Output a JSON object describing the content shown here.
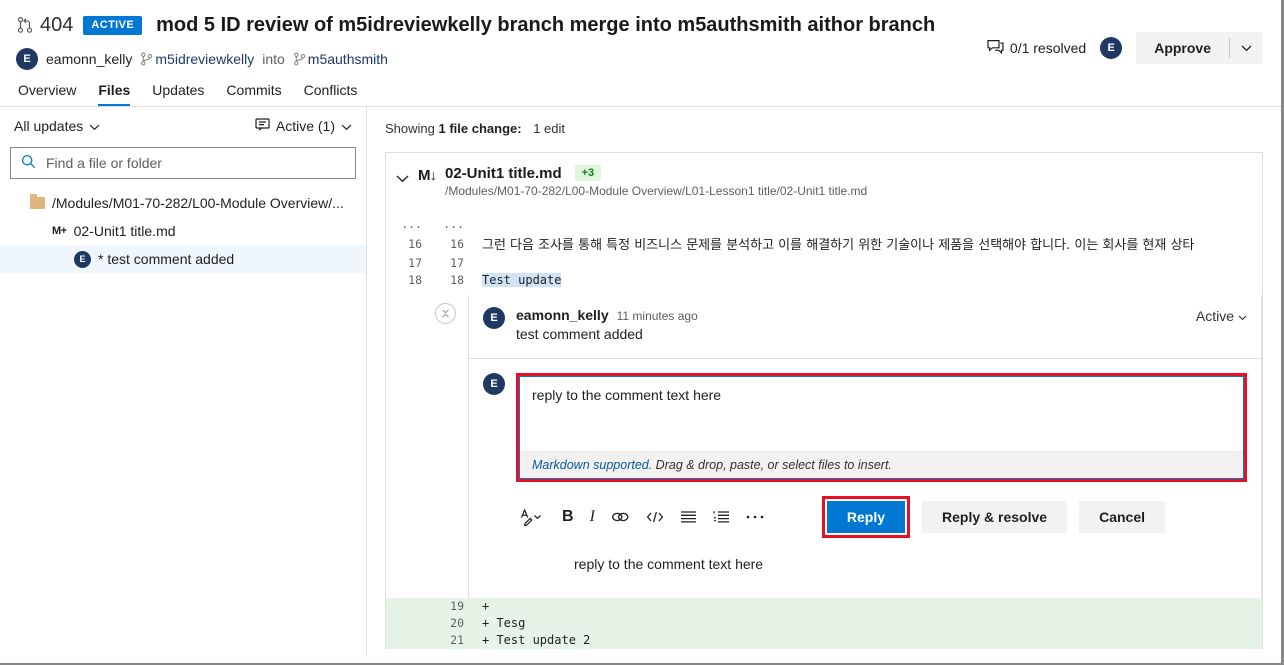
{
  "header": {
    "pr_id": "404",
    "status_badge": "ACTIVE",
    "title": "mod 5 ID review of m5idreviewkelly branch merge into m5authsmith aithor branch",
    "author_initial": "E",
    "author_name": "eamonn_kelly",
    "source_branch": "m5idreviewkelly",
    "into_word": "into",
    "target_branch": "m5authsmith",
    "resolved_count": "0/1 resolved",
    "reviewer_initial": "E",
    "approve_label": "Approve",
    "accent_blue": "#0078d4",
    "badge_blue": "#0078d4"
  },
  "tabs": [
    {
      "label": "Overview",
      "selected": false
    },
    {
      "label": "Files",
      "selected": true
    },
    {
      "label": "Updates",
      "selected": false
    },
    {
      "label": "Commits",
      "selected": false
    },
    {
      "label": "Conflicts",
      "selected": false
    }
  ],
  "sidebar": {
    "updates_filter": "All updates",
    "comments_filter": "Active (1)",
    "search_placeholder": "Find a file or folder",
    "search_value": "",
    "tree": {
      "folder": "/Modules/M01-70-282/L00-Module Overview/...",
      "file": "02-Unit1 title.md",
      "file_badge": "M+",
      "comment_initial": "E",
      "comment": "* test comment added"
    }
  },
  "main": {
    "showing_prefix": "Showing",
    "showing_count": "1 file change:",
    "showing_edits": "1 edit",
    "file": {
      "mod_badge": "M↓",
      "name": "02-Unit1 title.md",
      "added_badge": "+3",
      "path": "/Modules/M01-70-282/L00-Module Overview/L01-Lesson1 title/02-Unit1 title.md"
    },
    "diff_top": [
      {
        "old": "···",
        "new": "···",
        "text": "",
        "type": "ellipsis"
      },
      {
        "old": "16",
        "new": "16",
        "text": "그런 다음 조사를 통해 특정 비즈니스 문제를 분석하고 이를 해결하기 위한 기술이나 제품을 선택해야 합니다. 이는 회사를 현재 상타",
        "type": "context-korean"
      },
      {
        "old": "17",
        "new": "17",
        "text": "",
        "type": "context"
      },
      {
        "old": "18",
        "new": "18",
        "text": "Test update",
        "type": "context-highlight"
      }
    ],
    "diff_bottom": [
      {
        "num": "19",
        "text": "+ ",
        "type": "add"
      },
      {
        "num": "20",
        "text": "+ Tesg",
        "type": "add"
      },
      {
        "num": "21",
        "text": "+ Test update 2",
        "type": "add"
      }
    ],
    "thread": {
      "comment": {
        "avatar_initial": "E",
        "author": "eamonn_kelly",
        "time": "11 minutes ago",
        "text": "test comment added",
        "status": "Active"
      },
      "reply": {
        "avatar_initial": "E",
        "draft_text": "reply to the comment text here",
        "markdown_link": "Markdown supported.",
        "hint": " Drag & drop, paste, or select files to insert.",
        "toolbar_icons": [
          "font-style-icon",
          "bold-icon",
          "italic-icon",
          "link-icon",
          "code-icon",
          "bulleted-list-icon",
          "numbered-list-icon",
          "more-options-icon"
        ],
        "reply_button": "Reply",
        "reply_resolve_button": "Reply & resolve",
        "cancel_button": "Cancel",
        "echo_text": "reply to the comment text here",
        "highlight_color": "#e81123"
      }
    }
  }
}
